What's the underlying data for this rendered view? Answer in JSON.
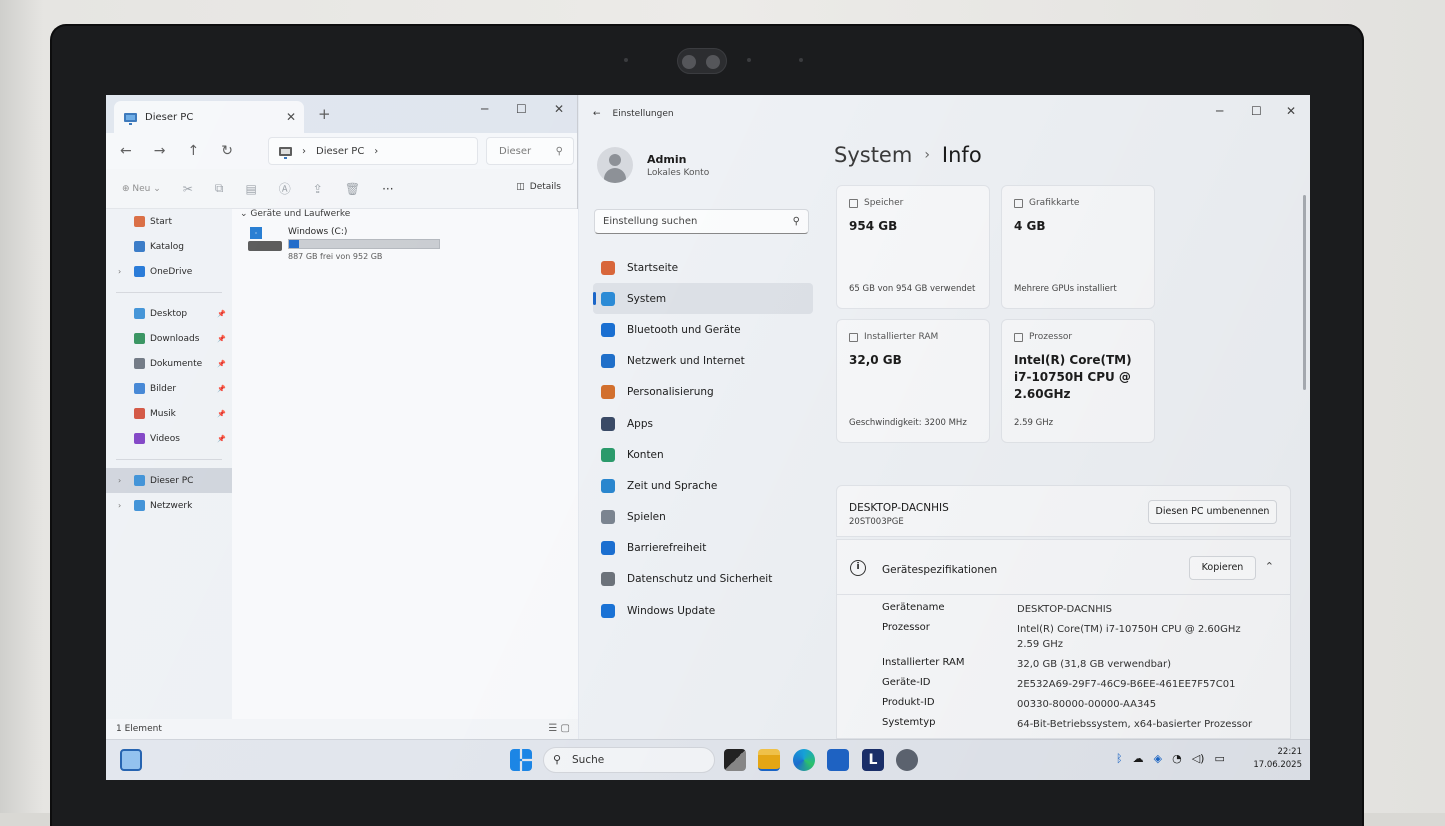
{
  "explorer": {
    "tab_title": "Dieser PC",
    "tab_close": "✕",
    "new_tab": "+",
    "window_controls": [
      "─",
      "☐",
      "✕"
    ],
    "nav": {
      "back": "←",
      "forward": "→",
      "up": "↑",
      "refresh": "↻"
    },
    "address": {
      "segment": "Dieser PC",
      "chevron": "›"
    },
    "search_placeholder": "Dieser",
    "search_icon": "magnifier-icon",
    "toolbar": {
      "new_label": "Neu",
      "more": "···",
      "details_label": "Details"
    },
    "sidebar": [
      {
        "label": "Start",
        "icon": "home-icon",
        "color": "#d8663a",
        "chevron": false,
        "pinned": false
      },
      {
        "label": "Katalog",
        "icon": "gallery-icon",
        "color": "#2e74c4",
        "chevron": false,
        "pinned": false
      },
      {
        "label": "OneDrive",
        "icon": "cloud-icon",
        "color": "#1d73d6",
        "chevron": true,
        "pinned": false
      },
      {
        "label": "Desktop",
        "icon": "desktop-icon",
        "color": "#3a8fd6",
        "chevron": false,
        "pinned": true
      },
      {
        "label": "Downloads",
        "icon": "download-icon",
        "color": "#2f8f5a",
        "chevron": false,
        "pinned": true
      },
      {
        "label": "Dokumente",
        "icon": "document-icon",
        "color": "#6b7480",
        "chevron": false,
        "pinned": true
      },
      {
        "label": "Bilder",
        "icon": "pictures-icon",
        "color": "#3d82d4",
        "chevron": false,
        "pinned": true
      },
      {
        "label": "Musik",
        "icon": "music-icon",
        "color": "#d1503d",
        "chevron": false,
        "pinned": true
      },
      {
        "label": "Videos",
        "icon": "video-icon",
        "color": "#7d3fc4",
        "chevron": false,
        "pinned": true
      },
      {
        "label": "Dieser PC",
        "icon": "pc-icon",
        "color": "#3a8fd6",
        "chevron": true,
        "pinned": false,
        "selected": true
      },
      {
        "label": "Netzwerk",
        "icon": "network-icon",
        "color": "#3a8fd6",
        "chevron": true,
        "pinned": false
      }
    ],
    "group_label": "Geräte und Laufwerke",
    "drive": {
      "name": "Windows (C:)",
      "free_text": "887 GB frei von 952 GB",
      "used_fraction": 0.068
    },
    "status": "1 Element"
  },
  "settings": {
    "app_title": "Einstellungen",
    "back": "←",
    "window_controls": [
      "─",
      "☐",
      "✕"
    ],
    "user": {
      "name": "Admin",
      "account_type": "Lokales Konto"
    },
    "search_placeholder": "Einstellung suchen",
    "nav": [
      {
        "label": "Startseite",
        "icon": "home-icon",
        "color": "#d8663a"
      },
      {
        "label": "System",
        "icon": "system-icon",
        "color": "#2c8bd6",
        "selected": true
      },
      {
        "label": "Bluetooth und Geräte",
        "icon": "bluetooth-icon",
        "color": "#1a6fd1"
      },
      {
        "label": "Netzwerk und Internet",
        "icon": "wifi-icon",
        "color": "#1f6fc9"
      },
      {
        "label": "Personalisierung",
        "icon": "brush-icon",
        "color": "#d2702e"
      },
      {
        "label": "Apps",
        "icon": "apps-icon",
        "color": "#3a4a66"
      },
      {
        "label": "Konten",
        "icon": "account-icon",
        "color": "#2b9a6b"
      },
      {
        "label": "Zeit und Sprache",
        "icon": "globe-clock-icon",
        "color": "#2a86cf"
      },
      {
        "label": "Spielen",
        "icon": "gamepad-icon",
        "color": "#7b8490"
      },
      {
        "label": "Barrierefreiheit",
        "icon": "accessibility-icon",
        "color": "#1b6fd1"
      },
      {
        "label": "Datenschutz und Sicherheit",
        "icon": "shield-icon",
        "color": "#6d737b"
      },
      {
        "label": "Windows Update",
        "icon": "update-icon",
        "color": "#1a73d6"
      }
    ],
    "breadcrumb": {
      "parent": "System",
      "separator": "›",
      "current": "Info"
    },
    "cards": [
      {
        "label": "Speicher",
        "value": "954 GB",
        "sub": "65 GB von 954 GB verwendet"
      },
      {
        "label": "Grafikkarte",
        "value": "4 GB",
        "sub": "Mehrere GPUs installiert"
      },
      {
        "label": "Installierter RAM",
        "value": "32,0 GB",
        "sub": "Geschwindigkeit: 3200 MHz"
      },
      {
        "label": "Prozessor",
        "value": "Intel(R) Core(TM) i7-10750H CPU @ 2.60GHz",
        "sub": "2.59 GHz"
      }
    ],
    "device": {
      "name": "DESKTOP-DACNHIS",
      "model": "20ST003PGE",
      "rename_button": "Diesen PC umbenennen"
    },
    "specs": {
      "title": "Gerätespezifikationen",
      "copy_button": "Kopieren",
      "collapse": "⌃",
      "rows": [
        {
          "key": "Gerätename",
          "value": "DESKTOP-DACNHIS"
        },
        {
          "key": "Prozessor",
          "value": "Intel(R) Core(TM) i7-10750H CPU @ 2.60GHz   2.59 GHz"
        },
        {
          "key": "Installierter RAM",
          "value": "32,0 GB (31,8 GB verwendbar)"
        },
        {
          "key": "Geräte-ID",
          "value": "2E532A69-29F7-46C9-B6EE-461EE7F57C01"
        },
        {
          "key": "Produkt-ID",
          "value": "00330-80000-00000-AA345"
        },
        {
          "key": "Systemtyp",
          "value": "64-Bit-Betriebssystem, x64-basierter Prozessor"
        }
      ]
    }
  },
  "taskbar": {
    "search_label": "Suche",
    "tray_icons": [
      "bluetooth-icon",
      "onedrive-icon",
      "defender-icon",
      "wifi-icon",
      "speaker-icon",
      "battery-icon"
    ],
    "time": "22:21",
    "date": "17.06.2025"
  }
}
